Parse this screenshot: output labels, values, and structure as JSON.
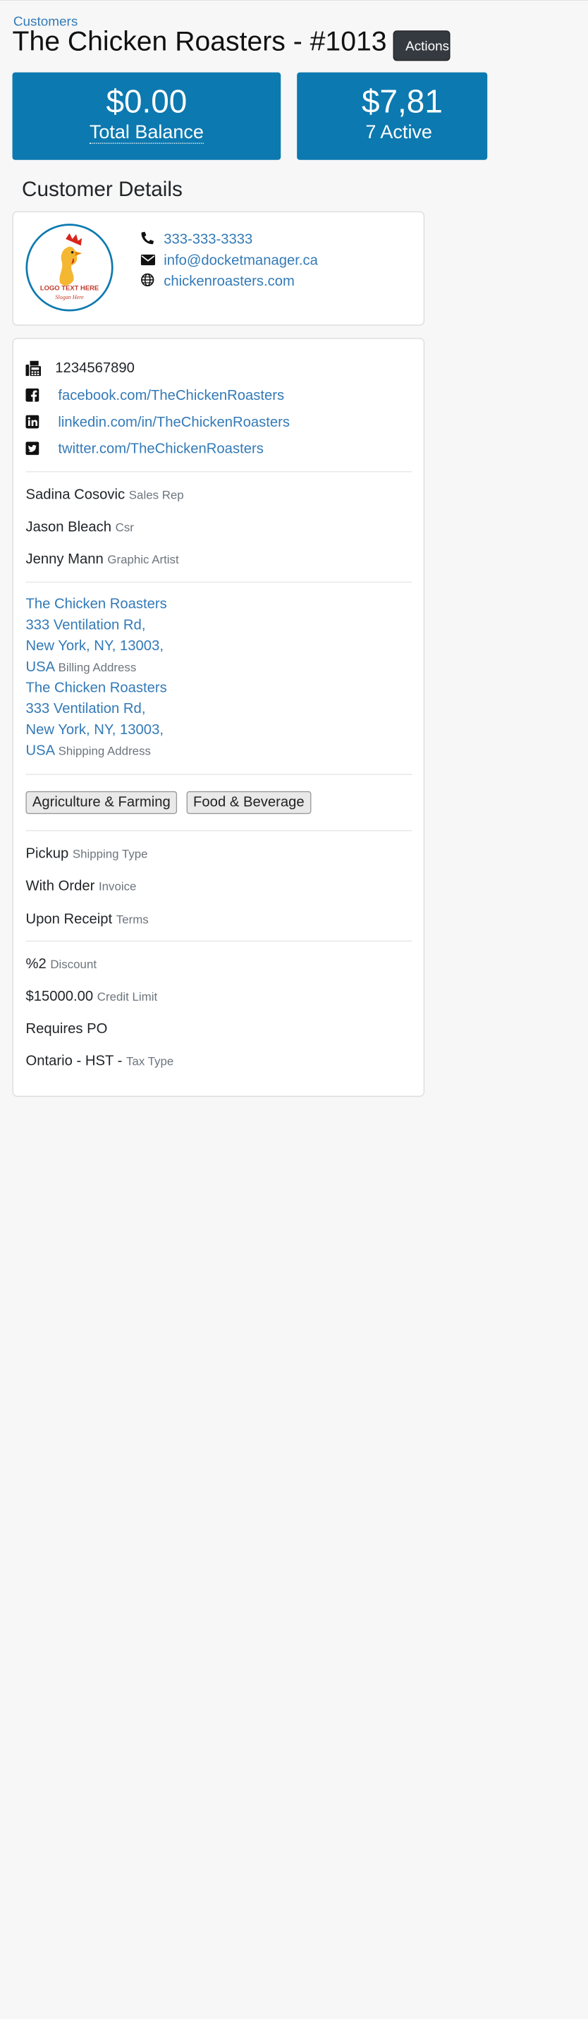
{
  "breadcrumb": "Customers",
  "title": "The Chicken Roasters - #1013",
  "actions_label": "Actions",
  "stats": [
    {
      "amount": "$0.00",
      "label": "Total Balance"
    },
    {
      "amount": "$7,81",
      "label": "7 Active"
    }
  ],
  "section_title": "Customer Details",
  "logo": {
    "main_text": "LOGO TEXT HERE",
    "slogan": "Slogan Here"
  },
  "contact": {
    "phone": "333-333-3333",
    "email": "info@docketmanager.ca",
    "website": "chickenroasters.com"
  },
  "details": {
    "fax": "1234567890",
    "facebook": "facebook.com/TheChickenRoasters",
    "linkedin": "linkedin.com/in/TheChickenRoasters",
    "twitter": "twitter.com/TheChickenRoasters"
  },
  "staff": [
    {
      "name": "Sadina Cosovic",
      "role": "Sales Rep"
    },
    {
      "name": "Jason Bleach",
      "role": "Csr"
    },
    {
      "name": "Jenny Mann",
      "role": "Graphic Artist"
    }
  ],
  "addresses": [
    {
      "line1": "The Chicken Roasters",
      "line2": "333 Ventilation Rd,",
      "line3": "New York, NY, 13003,",
      "line4": "USA",
      "type": "Billing Address"
    },
    {
      "line1": "The Chicken Roasters",
      "line2": "333 Ventilation Rd,",
      "line3": "New York, NY, 13003,",
      "line4": "USA",
      "type": "Shipping Address"
    }
  ],
  "tags": [
    "Agriculture & Farming",
    "Food & Beverage"
  ],
  "terms": [
    {
      "value": "Pickup",
      "label": "Shipping Type"
    },
    {
      "value": "With Order",
      "label": "Invoice"
    },
    {
      "value": "Upon Receipt",
      "label": "Terms"
    }
  ],
  "finance": [
    {
      "value": "%2",
      "label": "Discount"
    },
    {
      "value": "$15000.00",
      "label": "Credit Limit"
    },
    {
      "value": "Requires PO",
      "label": ""
    },
    {
      "value": "Ontario - HST -",
      "label": "Tax Type"
    }
  ],
  "colors": {
    "primary": "#0c79b0",
    "link": "#337ab7",
    "muted": "#6c757d"
  },
  "icons": [
    "phone-icon",
    "envelope-icon",
    "globe-icon",
    "fax-icon",
    "facebook-icon",
    "linkedin-icon",
    "twitter-icon"
  ]
}
